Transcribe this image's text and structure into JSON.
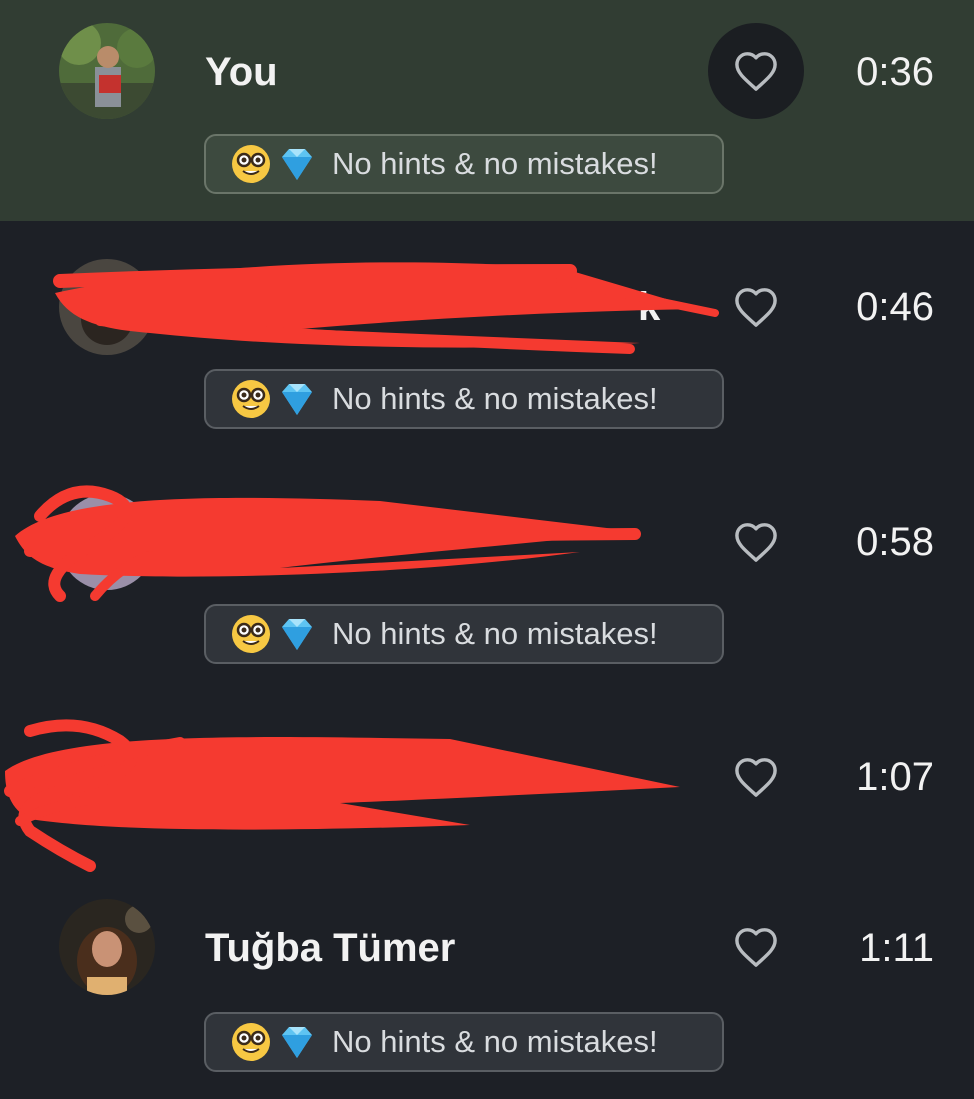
{
  "leaderboard": {
    "entries": [
      {
        "name": "You",
        "time": "0:36",
        "badge": "No hints & no mistakes!",
        "highlighted": true,
        "liked": true,
        "redacted": false
      },
      {
        "name": "",
        "visible_fragment": "k",
        "time": "0:46",
        "badge": "No hints & no mistakes!",
        "highlighted": false,
        "liked": false,
        "redacted": true
      },
      {
        "name": "",
        "time": "0:58",
        "badge": "No hints & no mistakes!",
        "highlighted": false,
        "liked": false,
        "redacted": true
      },
      {
        "name": "",
        "time": "1:07",
        "badge": "",
        "highlighted": false,
        "liked": false,
        "redacted": true
      },
      {
        "name": "Tuğba Tümer",
        "time": "1:11",
        "badge": "No hints & no mistakes!",
        "highlighted": false,
        "liked": false,
        "redacted": false
      }
    ]
  },
  "icons": {
    "badge_emoji_1": "nerd-face-icon",
    "badge_emoji_2": "gem-icon",
    "like": "heart-outline-icon"
  },
  "colors": {
    "background": "#1d2026",
    "highlight_row": "#313d33",
    "redaction": "#f53a30",
    "text": "#f2f2f2"
  }
}
